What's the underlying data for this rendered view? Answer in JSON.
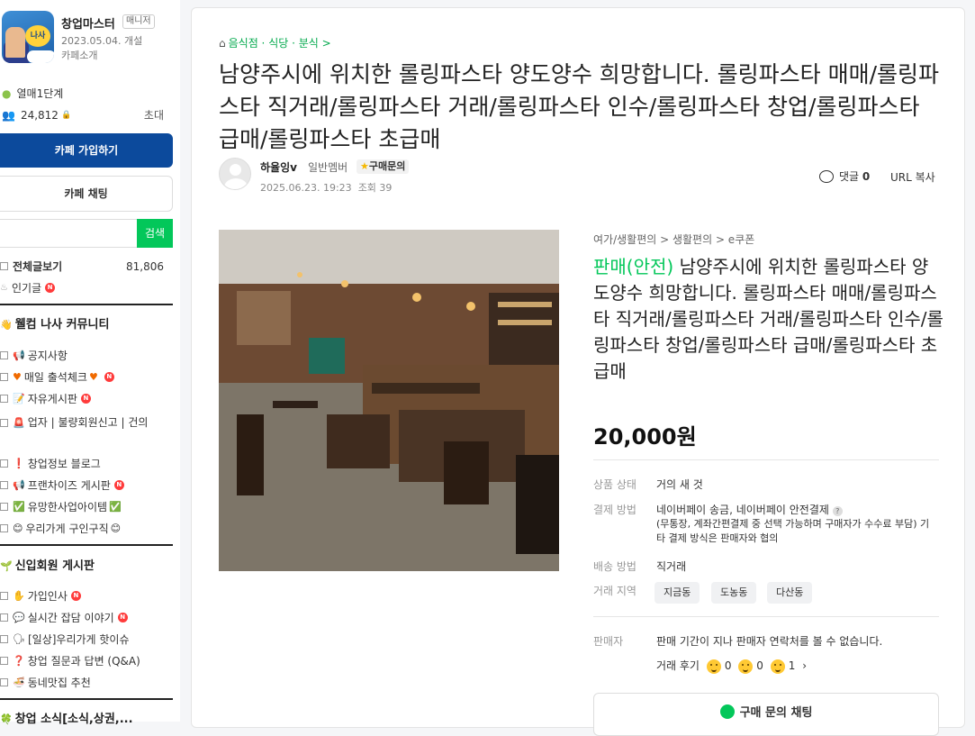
{
  "cafe": {
    "name": "창업마스터",
    "role_tag": "매니저",
    "founded": "2023.05.04. 개설",
    "intro_link": "카페소개",
    "logo_text": "나사",
    "level": "열매1단계",
    "members": "24,812",
    "invite": "초대",
    "join_button": "카페 가입하기",
    "chat_button": "카페 채팅",
    "search_button": "검색",
    "search_value": ""
  },
  "menu": {
    "all_posts": "전체글보기",
    "all_posts_count": "81,806",
    "popular": "인기글",
    "section1_title": "웰컴 나사 커뮤니티",
    "section1": [
      "공지사항",
      "매일 출석체크",
      "자유게시판",
      "업자 | 불량회원신고 | 건의",
      "창업정보 블로그",
      "프랜차이즈 게시판",
      "유망한사업아이템",
      "우리가게 구인구직"
    ],
    "section2_title": "신입회원 게시판",
    "section2": [
      "가입인사",
      "실시간 잡담 이야기",
      "[일상]우리가게 핫이슈",
      "창업 질문과 답변 (Q&A)",
      "동네맛집 추천"
    ],
    "section3_title": "창업 소식[소식,상권,..."
  },
  "post": {
    "breadcrumb": "음식점 · 식당 · 분식 >",
    "title": "남양주시에 위치한 롤링파스타 양도양수 희망합니다. 롤링파스타 매매/롤링파스타 직거래/롤링파스타 거래/롤링파스타 인수/롤링파스타 창업/롤링파스타 급매/롤링파스타 초급매",
    "author": "하율잉v",
    "author_grade": "일반멤버",
    "buy_inquiry": "구매문의",
    "date": "2025.06.23. 19:23",
    "views": "조회 39",
    "comment_label": "댓글",
    "comment_count": "0",
    "url_copy": "URL 복사"
  },
  "product": {
    "category": "여가/생활편의 > 생활편의 > e쿠폰",
    "status_tag": "판매(안전)",
    "title": "남양주시에 위치한 롤링파스타 양도양수 희망합니다. 롤링파스타 매매/롤링파스타 직거래/롤링파스타 거래/롤링파스타 인수/롤링파스타 창업/롤링파스타 급매/롤링파스타 초급매",
    "price": "20,000원",
    "condition_label": "상품 상태",
    "condition": "거의 새 것",
    "payment_label": "결제 방법",
    "payment": "네이버페이 송금, 네이버페이 안전결제",
    "payment_note": "(무통장, 계좌간편결제 중 선택 가능하며 구매자가 수수료 부담) 기타 결제 방식은 판매자와 협의",
    "delivery_label": "배송 방법",
    "delivery": "직거래",
    "area_label": "거래 지역",
    "areas": [
      "지금동",
      "도농동",
      "다산동"
    ],
    "seller_label": "판매자",
    "seller_note": "판매 기간이 지나 판매자 연락처를 볼 수 없습니다.",
    "review_label": "거래 후기",
    "review_counts": [
      "0",
      "0",
      "1"
    ],
    "chat_button": "구매 문의 채팅"
  },
  "colors": {
    "naver_green": "#03c75a",
    "join_blue": "#0c4a9c"
  }
}
